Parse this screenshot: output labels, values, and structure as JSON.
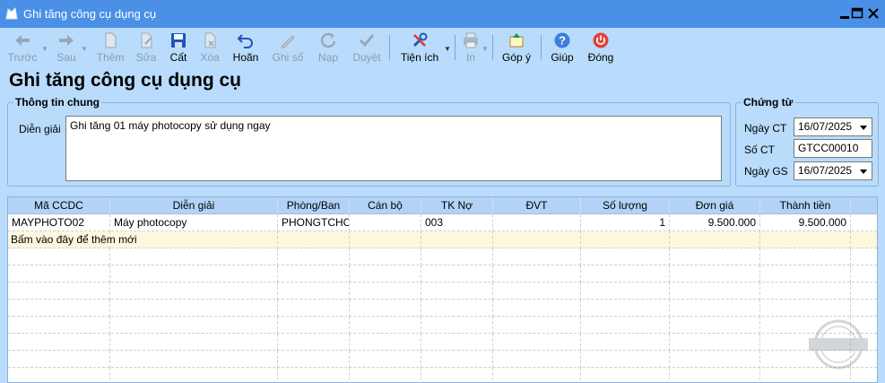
{
  "window": {
    "title": "Ghi tăng công cụ dụng cụ"
  },
  "toolbar": {
    "prev": "Trước",
    "next": "Sau",
    "add": "Thêm",
    "edit": "Sửa",
    "save": "Cất",
    "delete": "Xóa",
    "undo": "Hoãn",
    "post": "Ghi sổ",
    "load": "Nạp",
    "approve": "Duyệt",
    "utilities": "Tiện ích",
    "print": "In",
    "feedback": "Góp ý",
    "help": "Giúp",
    "close": "Đóng"
  },
  "page": {
    "title": "Ghi tăng công cụ dụng cụ"
  },
  "general_info": {
    "legend": "Thông tin chung",
    "description_label": "Diễn giải",
    "description_value": "Ghi tăng 01 máy photocopy sử dụng ngay"
  },
  "voucher": {
    "legend": "Chứng từ",
    "date_label": "Ngày CT",
    "date_value": "16/07/2025",
    "number_label": "Số CT",
    "number_value": "GTCC00010",
    "post_date_label": "Ngày GS",
    "post_date_value": "16/07/2025"
  },
  "grid": {
    "columns": [
      "Mã CCDC",
      "Diễn giải",
      "Phòng/Ban",
      "Cán bộ",
      "TK Nợ",
      "ĐVT",
      "Số lượng",
      "Đơn giá",
      "Thành tiền"
    ],
    "rows": [
      [
        "MAYPHOTO02",
        "Máy photocopy",
        "PHONGTCHC",
        "",
        "003",
        "",
        "1",
        "9.500.000",
        "9.500.000"
      ]
    ],
    "new_row_text": "Bấm vào đây để thêm mới"
  },
  "colors": {
    "titlebar": "#4a90e6",
    "background": "#b9dcfc",
    "new_row": "#fcf8dd"
  }
}
